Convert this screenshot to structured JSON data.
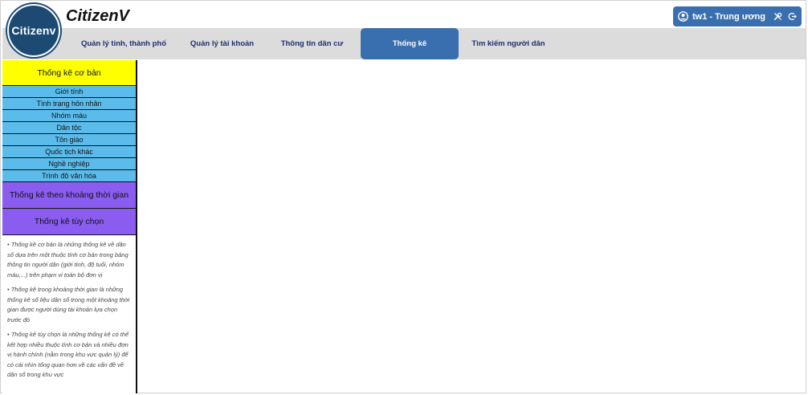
{
  "app": {
    "logo_text": "Citizenv",
    "title": "CitizenV"
  },
  "user": {
    "label": "tw1 - Trung ương"
  },
  "nav": {
    "items": [
      "Quản lý tỉnh, thành phố",
      "Quản lý tài khoản",
      "Thông tin dân cư",
      "Thống kê",
      "Tìm kiếm người dân"
    ],
    "active_index": 3
  },
  "sidebar": {
    "header": "Thống kê cơ bản",
    "basic_items": [
      "Giới tính",
      "Tình trạng hôn nhân",
      "Nhóm máu",
      "Dân tộc",
      "Tôn giáo",
      "Quốc tịch khác",
      "Nghề nghiệp",
      "Trình độ văn hóa"
    ],
    "time_stats": "Thống kê theo khoảng thời gian",
    "custom_stats": "Thống kê tùy chọn",
    "notes": [
      "• Thống kê cơ bản là những thống kê về dân số dựa trên một thuộc tính cơ bản trong bảng thông tin người dân (giới tính, độ tuổi, nhóm máu,...) trên phạm vi toàn bộ đơn vị",
      "• Thống kê trong khoảng thời gian là những thống kê số liệu dân số trong một khoảng thời gian được người dùng tài khoản lựa chọn trước đó",
      "• Thống kê tùy chọn là những thống kê có thể kết hợp nhiều thuộc tính cơ bản và nhiều đơn vị hành chính (nằm trong khu vực quản lý) để có cái nhìn tổng quan hơn về các vấn đề về dân số trong khu vực"
    ]
  },
  "colors": {
    "brand": "#1c4a72",
    "accent": "#3a6faf",
    "nav_bg": "#dcdcdc",
    "sidebar_header": "#ffff00",
    "sidebar_item": "#5bbcec",
    "sidebar_purple": "#8a5cf0"
  },
  "icons": {
    "user": "user-circle-icon",
    "tools": "tools-icon",
    "logout": "logout-icon"
  }
}
